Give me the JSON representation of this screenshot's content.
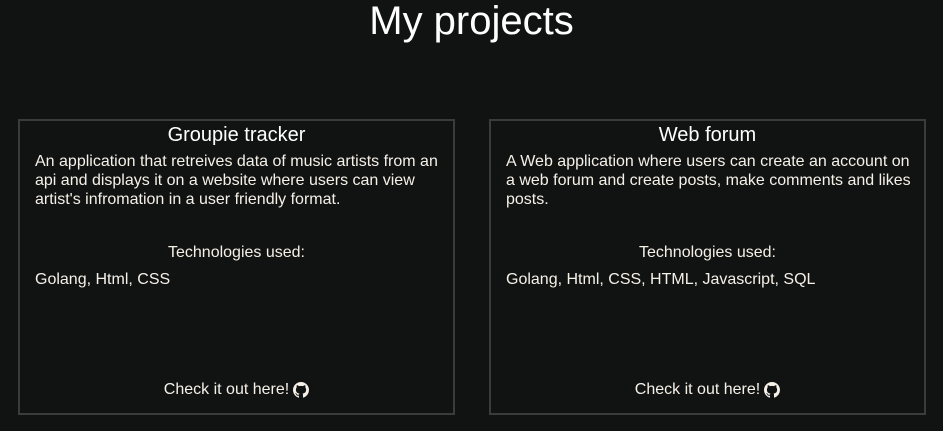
{
  "page": {
    "title": "My projects"
  },
  "projects": [
    {
      "title": "Groupie tracker",
      "description": "An application that retreives data of music artists from an api and displays it on a website where users can view artist's infromation in a user friendly format.",
      "tech_heading": "Technologies used:",
      "technologies": "Golang, Html, CSS",
      "cta_label": "Check it out here!",
      "cta_icon": "github-icon"
    },
    {
      "title": "Web forum",
      "description": "A Web application where users can create an account on a web forum and create posts, make comments and likes posts.",
      "tech_heading": "Technologies used:",
      "technologies": "Golang, Html, CSS, HTML, Javascript, SQL",
      "cta_label": "Check it out here!",
      "cta_icon": "github-icon"
    }
  ],
  "colors": {
    "background": "#111312",
    "card_border": "#3a3c3b",
    "text": "#f5f0e8",
    "heading": "#ffffff"
  }
}
